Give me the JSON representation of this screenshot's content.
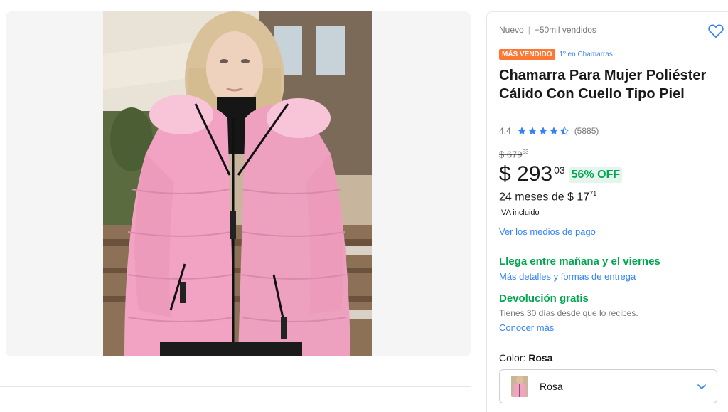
{
  "product": {
    "condition": "Nuevo",
    "sold": "+50mil vendidos",
    "badge_best_seller": "MÁS VENDIDO",
    "badge_rank": "1º en Chamarras",
    "title": "Chamarra Para Mujer Poliéster Cálido Con Cuello Tipo Piel",
    "rating_value": "4.4",
    "rating_stars": 4.4,
    "rating_count": "(5885)"
  },
  "price": {
    "original_prefix": "$ 679",
    "original_cents": "53",
    "current_prefix": "$ 293",
    "current_cents": "03",
    "discount": "56% OFF",
    "installments_text": "24 meses de $ 17",
    "installments_cents": "71",
    "tax_note": "IVA incluido",
    "payment_link": "Ver los medios de pago"
  },
  "shipping": {
    "title": "Llega entre mañana y el viernes",
    "details_link": "Más detalles y formas de entrega"
  },
  "returns": {
    "title": "Devolución gratis",
    "text": "Tienes 30 días desde que lo recibes.",
    "link": "Conocer más"
  },
  "variation": {
    "label": "Color: ",
    "selected": "Rosa",
    "select_value": "Rosa"
  },
  "icons": {
    "favorite": "heart-icon",
    "star": "star-icon",
    "chevron": "chevron-down-icon"
  },
  "colors": {
    "accent_blue": "#3483fa",
    "green": "#00a650",
    "badge_orange": "#ff7733",
    "jacket_pink": "#f2a3c3"
  }
}
